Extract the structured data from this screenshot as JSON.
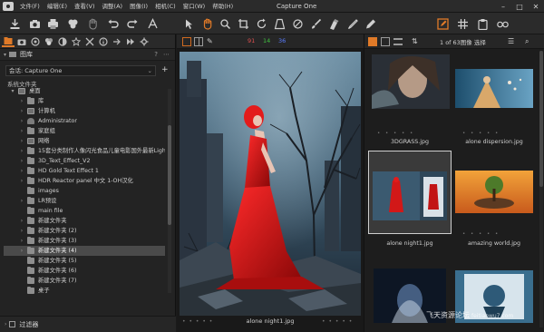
{
  "window": {
    "title": "Capture One",
    "controls": [
      "minimize-icon",
      "maximize-icon",
      "close-icon"
    ]
  },
  "menu": {
    "items": [
      "文件(F)",
      "编辑(E)",
      "查看(V)",
      "调整(A)",
      "图像(I)",
      "相机(C)",
      "窗口(W)",
      "帮助(H)"
    ]
  },
  "toolbar": {
    "left_icons": [
      "import-icon",
      "camera-icon",
      "print-icon",
      "delete-icon",
      "hand-icon",
      "undo-icon",
      "redo-icon",
      "text-icon"
    ],
    "center_icons": [
      "select-cursor-icon",
      "pan-icon",
      "zoom-icon",
      "crop-icon",
      "rotate-icon",
      "keystone-icon",
      "spot-remove-icon",
      "brush-icon",
      "eraser-icon",
      "color-picker-icon",
      "annotate-icon"
    ],
    "right_icons": [
      "edit-icon",
      "grid-icon",
      "clipboard-icon",
      "glasses-icon"
    ],
    "accent_color": "#e07a28"
  },
  "left_panel": {
    "tool_tabs": [
      "library-icon",
      "capture-icon",
      "lens-icon",
      "color-icon",
      "exposure-icon",
      "details-icon",
      "adjustments-icon",
      "metadata-icon",
      "output-icon",
      "batch-icon",
      "settings-icon"
    ],
    "header_title": "图库",
    "header_icons": [
      "help-icon",
      "menu-icon"
    ],
    "catalog_label": "会话: Capture One",
    "section_title": "系统文件夹",
    "tree": [
      {
        "label": "桌面",
        "level": 0,
        "arrow": "▾",
        "icon": "drive",
        "selected": false
      },
      {
        "label": "库",
        "level": 1,
        "arrow": "›",
        "icon": "folder",
        "selected": false
      },
      {
        "label": "计算机",
        "level": 1,
        "arrow": "›",
        "icon": "drive",
        "selected": false
      },
      {
        "label": "Administrator",
        "level": 1,
        "arrow": "›",
        "icon": "user",
        "selected": false
      },
      {
        "label": "家庭组",
        "level": 1,
        "arrow": "›",
        "icon": "folder",
        "selected": false
      },
      {
        "label": "网络",
        "level": 1,
        "arrow": "›",
        "icon": "drive",
        "selected": false
      },
      {
        "label": "15套分类制作人像闪光食品儿童电影国外最新Light",
        "level": 1,
        "arrow": "›",
        "icon": "folder",
        "selected": false
      },
      {
        "label": "3D_Text_Effect_V2",
        "level": 1,
        "arrow": "›",
        "icon": "folder",
        "selected": false
      },
      {
        "label": "HD Gold Text Effect 1",
        "level": 1,
        "arrow": "›",
        "icon": "folder",
        "selected": false
      },
      {
        "label": "HDR Reactor panel 中文 1-OH汉化",
        "level": 1,
        "arrow": "›",
        "icon": "folder",
        "selected": false
      },
      {
        "label": "images",
        "level": 1,
        "arrow": "",
        "icon": "folder",
        "selected": false
      },
      {
        "label": "LR预设",
        "level": 1,
        "arrow": "›",
        "icon": "folder",
        "selected": false
      },
      {
        "label": "main file",
        "level": 1,
        "arrow": "",
        "icon": "folder",
        "selected": false
      },
      {
        "label": "新建文件夹",
        "level": 1,
        "arrow": "›",
        "icon": "folder",
        "selected": false
      },
      {
        "label": "新建文件夹 (2)",
        "level": 1,
        "arrow": "›",
        "icon": "folder",
        "selected": false
      },
      {
        "label": "新建文件夹 (3)",
        "level": 1,
        "arrow": "›",
        "icon": "folder",
        "selected": false
      },
      {
        "label": "新建文件夹 (4)",
        "level": 1,
        "arrow": "›",
        "icon": "folder",
        "selected": true
      },
      {
        "label": "新建文件夹 (5)",
        "level": 1,
        "arrow": "",
        "icon": "folder",
        "selected": false
      },
      {
        "label": "新建文件夹 (6)",
        "level": 1,
        "arrow": "",
        "icon": "folder",
        "selected": false
      },
      {
        "label": "新建文件夹 (7)",
        "level": 1,
        "arrow": "",
        "icon": "folder",
        "selected": false
      },
      {
        "label": "桌子",
        "level": 1,
        "arrow": "",
        "icon": "folder",
        "selected": false
      }
    ],
    "filter_title": "过滤器"
  },
  "viewer": {
    "exposure_counts": [
      {
        "value": "91",
        "color": "#e05050"
      },
      {
        "value": "14",
        "color": "#40c040"
      },
      {
        "value": "36",
        "color": "#5a7dff"
      }
    ],
    "caption": "alone night1.jpg",
    "stars": "• • • • •"
  },
  "browser": {
    "count_label": "1 of 63图像 选择",
    "thumbnails": [
      {
        "name": "3DGRASS.jpg",
        "stars": "• • • • •",
        "selected": false
      },
      {
        "name": "alone dispersion.jpg",
        "stars": "• • • • •",
        "selected": false
      },
      {
        "name": "alone night1.jpg",
        "stars": "• • • • •",
        "selected": true
      },
      {
        "name": "amazing world.jpg",
        "stars": "• • • • •",
        "selected": false
      },
      {
        "name": "",
        "stars": "",
        "selected": false
      },
      {
        "name": "",
        "stars": "",
        "selected": false
      }
    ]
  },
  "watermark": {
    "text": "飞天资源论坛",
    "sub": "feitianwu7.com"
  }
}
